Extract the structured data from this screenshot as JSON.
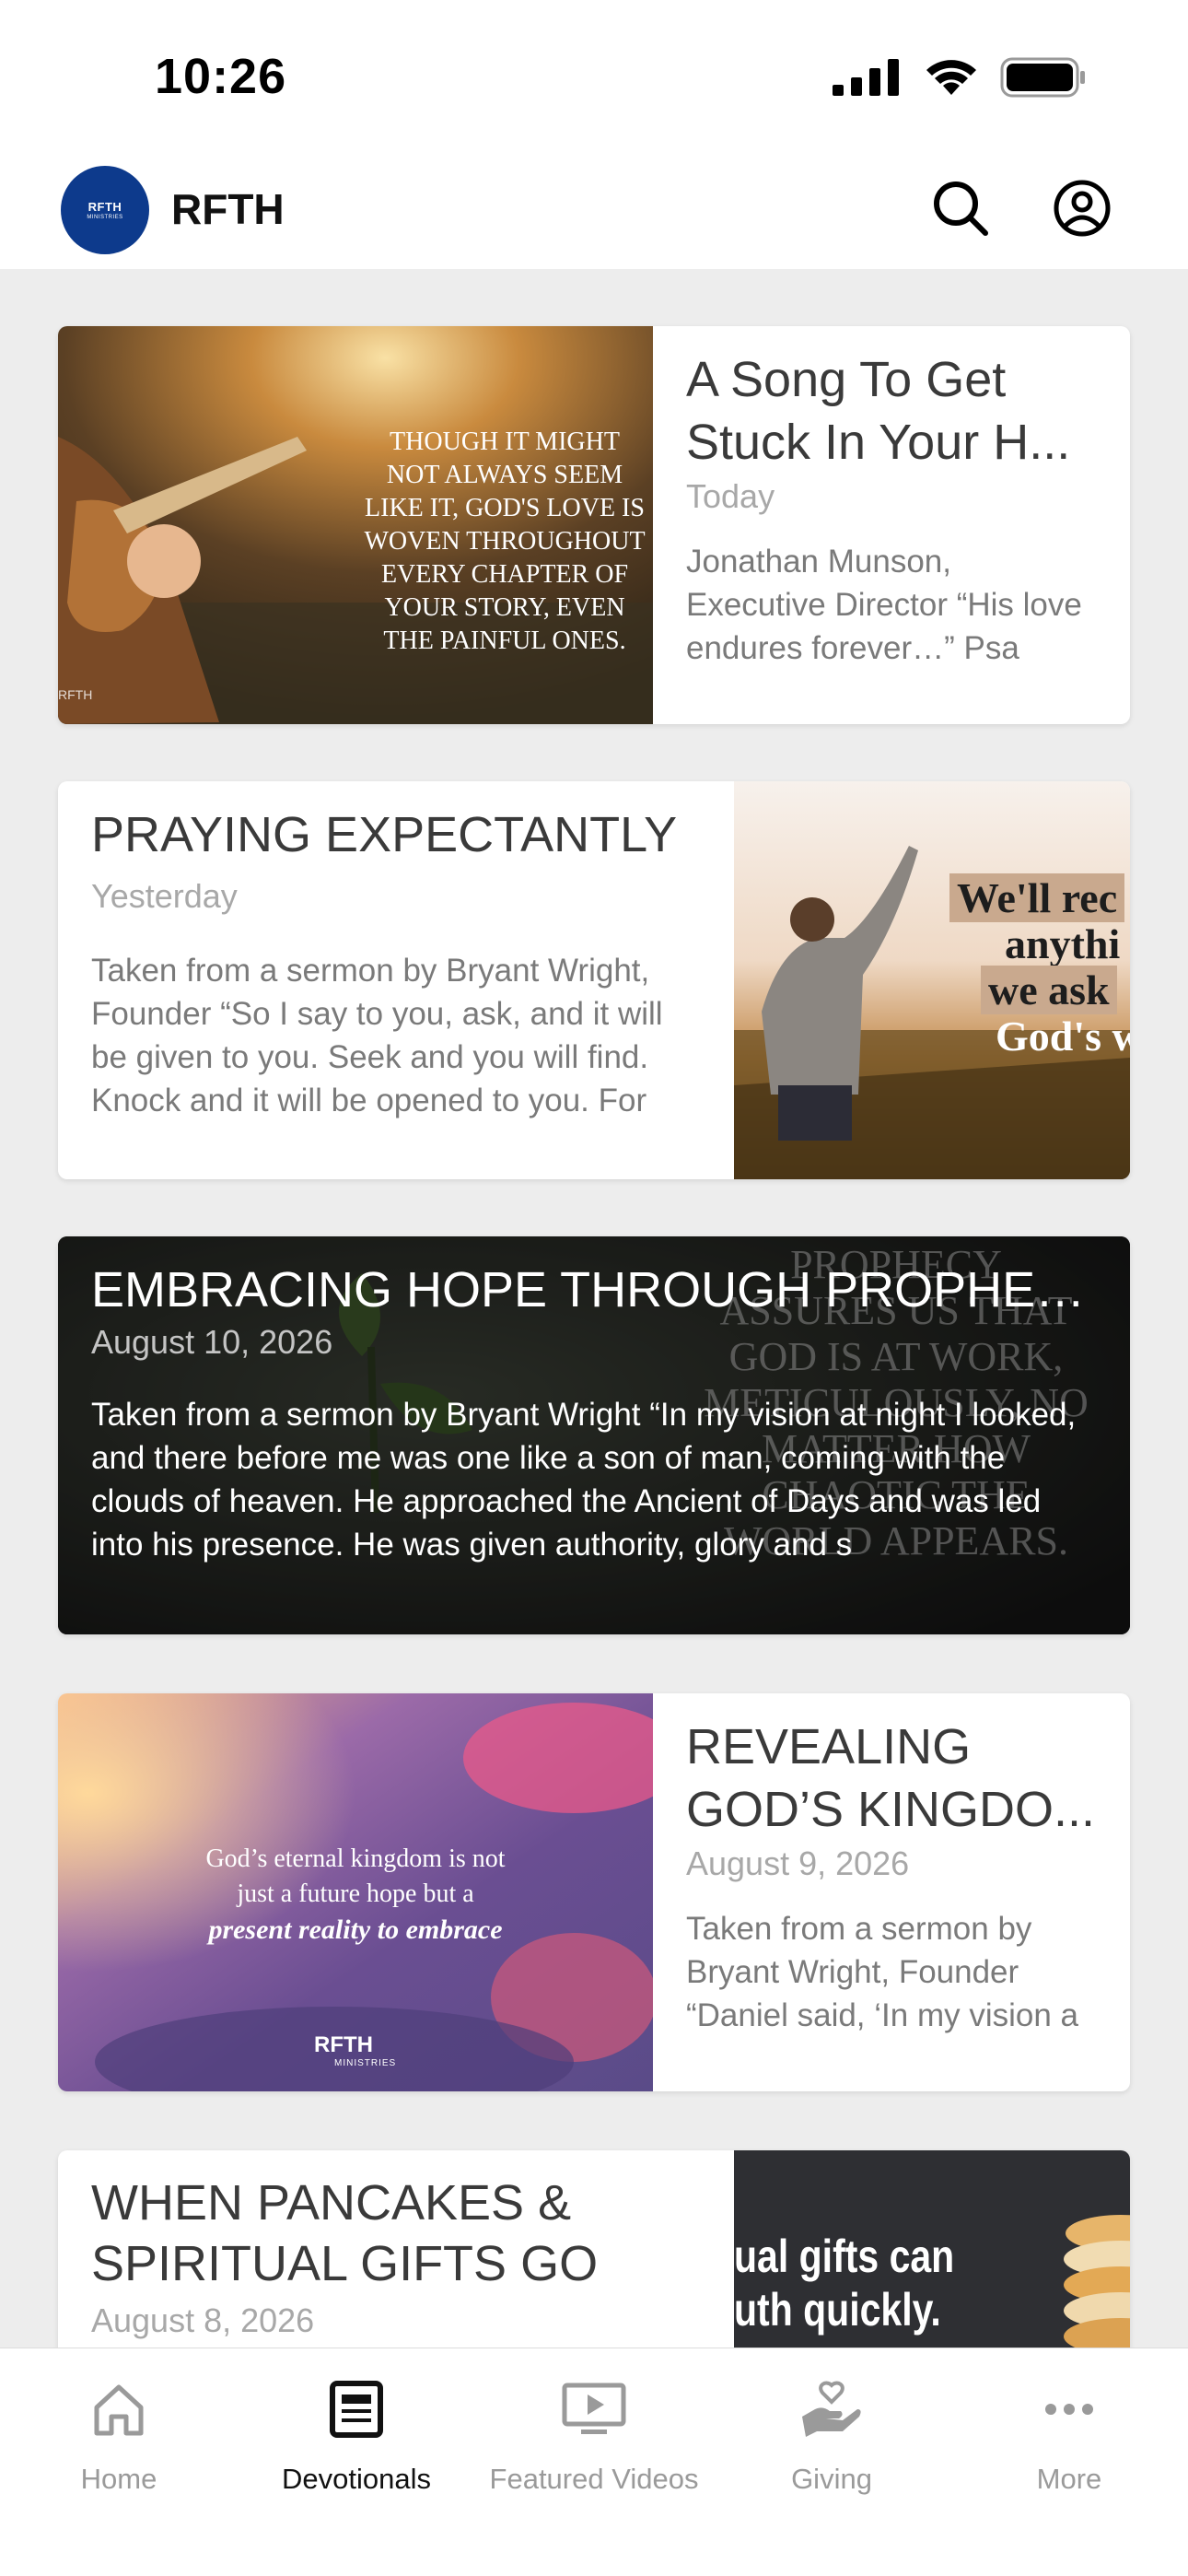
{
  "status_bar": {
    "time": "10:26"
  },
  "header": {
    "logo_text": "RFTH",
    "logo_subtext": "MINISTRIES",
    "title": "RFTH",
    "icons": [
      "search-icon",
      "account-icon"
    ]
  },
  "cards": [
    {
      "title": "A Song To Get Stuck In Your H...",
      "date": "Today",
      "excerpt": "Jonathan Munson, Executive Director “His love endures forever…” Psa",
      "image_text": "THOUGH IT MIGHT NOT ALWAYS SEEM LIKE IT, GOD'S LOVE IS WOVEN THROUGHOUT EVERY CHAPTER OF YOUR STORY, EVEN THE PAINFUL ONES.",
      "image_brand": "RFTH"
    },
    {
      "title": "PRAYING EXPECTANTLY",
      "date": "Yesterday",
      "excerpt": "Taken from a sermon by Bryant Wright, Founder “So I say to you, ask, and it will be given to you. Seek and you will find. Knock and it will be opened to you. For",
      "image_lines": [
        "We'll rec",
        "anythi",
        "we ask",
        "God's w"
      ]
    },
    {
      "title": "EMBRACING HOPE THROUGH PROPHETI...",
      "date": "August 10, 2026",
      "excerpt": "Taken from a sermon by Bryant Wright “In my vision at night I looked, and there before me was one like a son of man, coming with the clouds of heaven. He approached the Ancient of Days and was led into his presence. He was given authority, glory and s",
      "image_text": "PROPHECY ASSURES US THAT GOD IS AT WORK, METICULOUSLY, NO MATTER HOW CHAOTIC THE WORLD APPEARS."
    },
    {
      "title": "REVEALING GOD’S KINGDO...",
      "date": "August 9, 2026",
      "excerpt": "Taken from a sermon by Bryant Wright, Founder “Daniel said, ‘In my vision a",
      "image_line1": "God’s eternal kingdom is not",
      "image_line2": "just a future hope but a",
      "image_line3": "present reality to embrace",
      "image_brand": "RFTH",
      "image_brand_sub": "MINISTRIES"
    },
    {
      "title": "WHEN PANCAKES & SPIRITUAL GIFTS GO BAD",
      "date": "August 8, 2026",
      "image_lines": [
        "ual gifts can",
        "uth quickly."
      ]
    }
  ],
  "nav": [
    {
      "label": "Home",
      "icon": "home-icon",
      "active": false
    },
    {
      "label": "Devotionals",
      "icon": "devotionals-icon",
      "active": true
    },
    {
      "label": "Featured Videos",
      "icon": "video-icon",
      "active": false
    },
    {
      "label": "Giving",
      "icon": "giving-icon",
      "active": false
    },
    {
      "label": "More",
      "icon": "more-icon",
      "active": false
    }
  ],
  "colors": {
    "brand": "#0d3a8c",
    "background": "#ededed",
    "card": "#ffffff",
    "nav_active": "#111111",
    "nav_inactive": "#9a9a9a"
  }
}
